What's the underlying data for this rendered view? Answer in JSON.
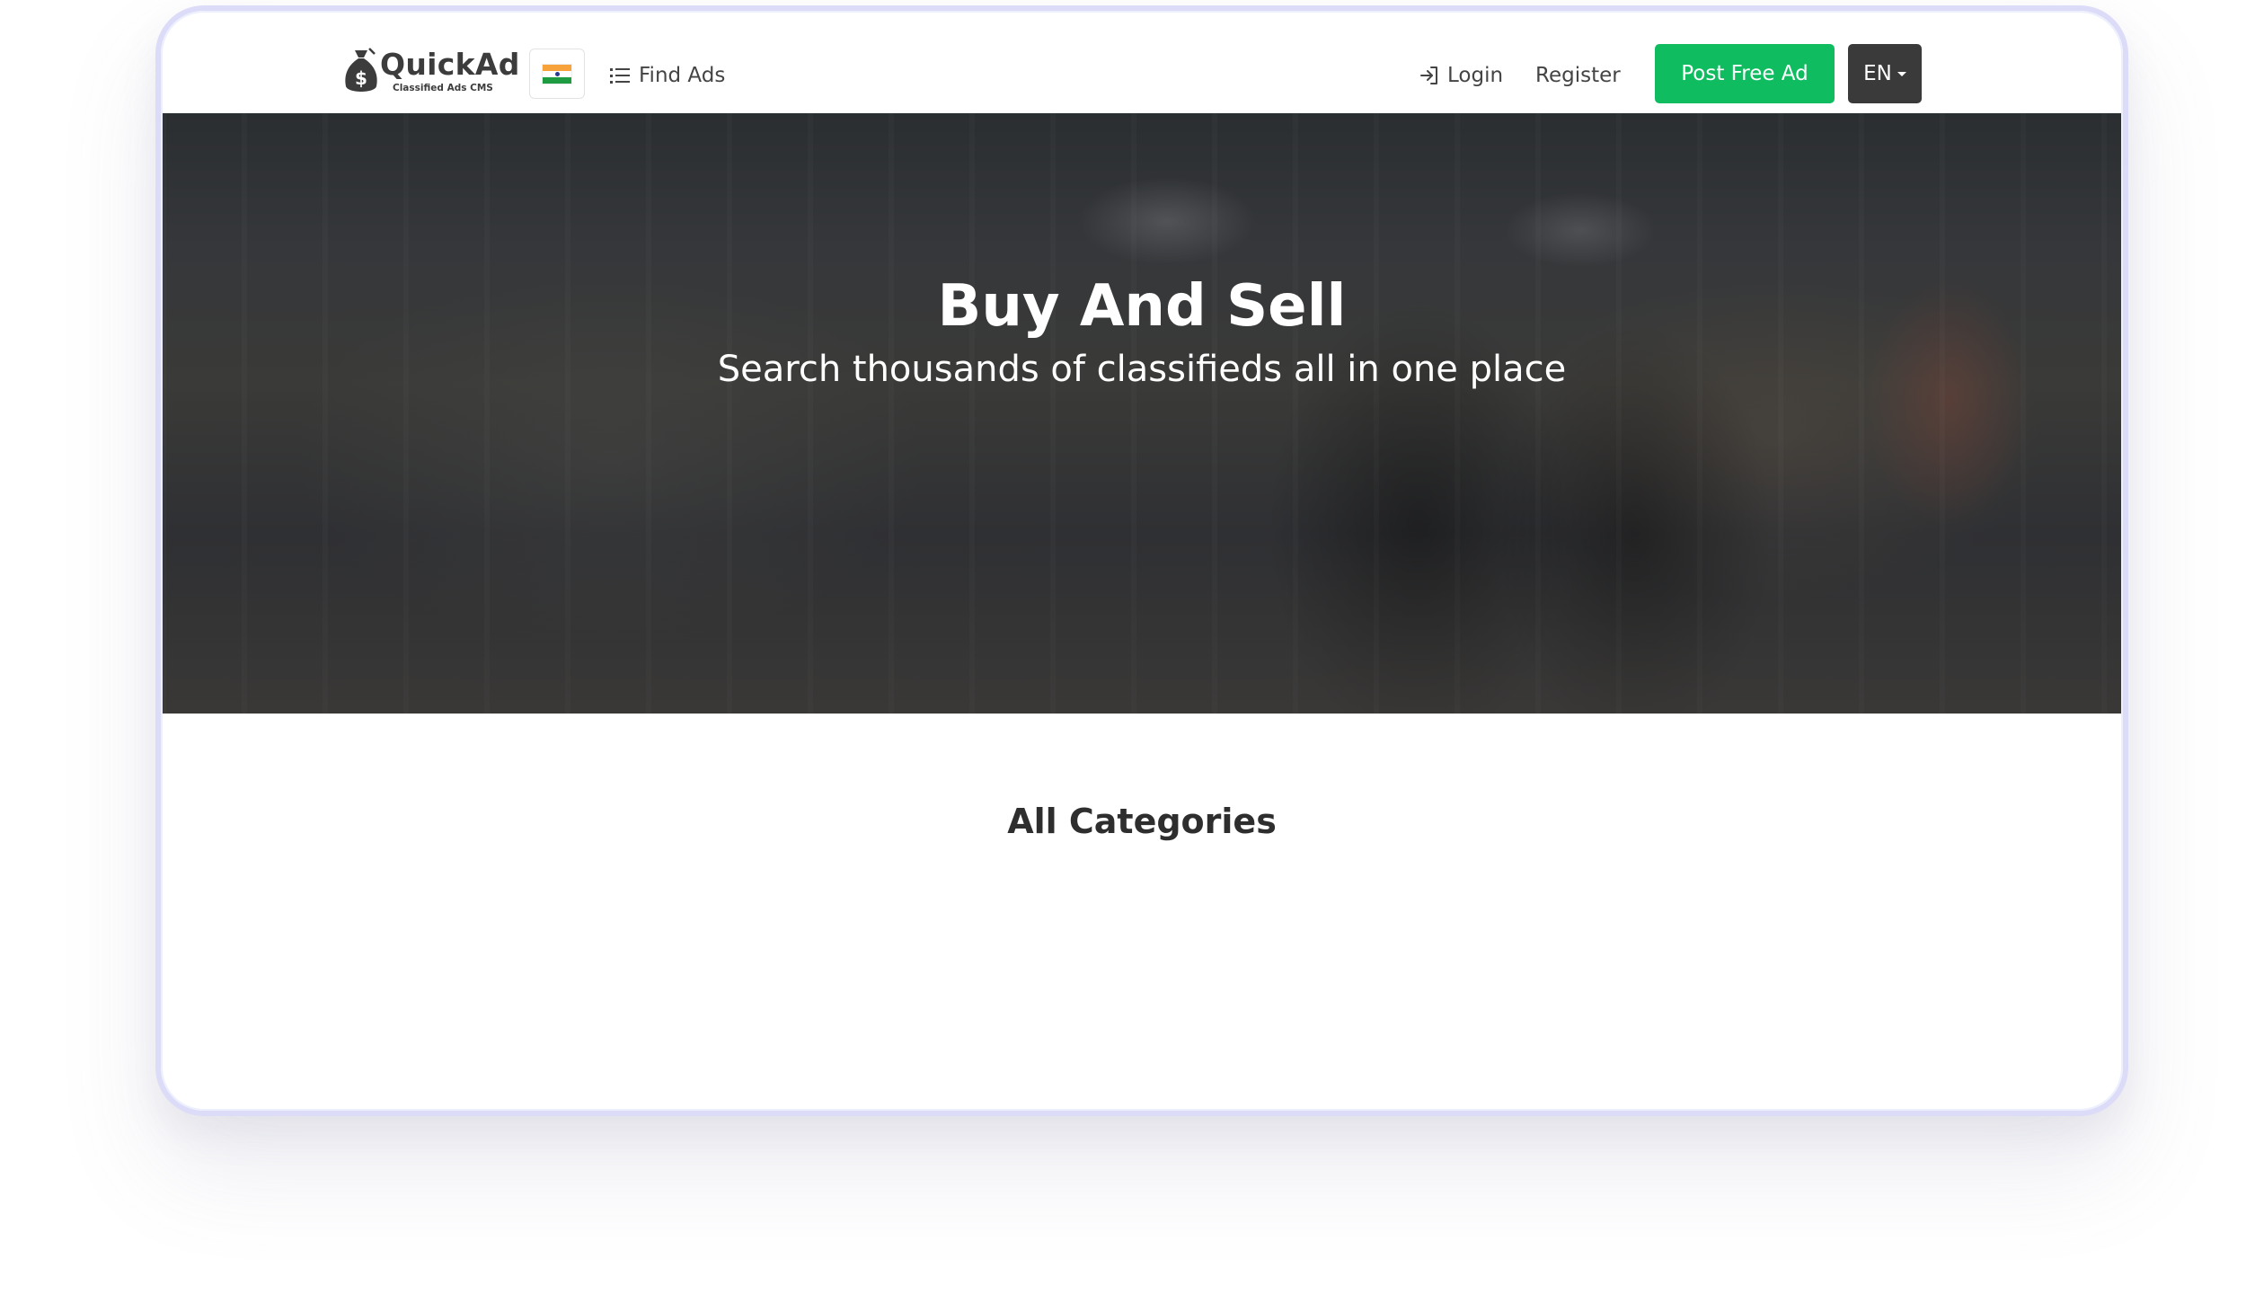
{
  "brand": {
    "name": "QuickAd",
    "tagline": "Classified Ads CMS",
    "icon": "money-bag-icon"
  },
  "nav": {
    "country_flag": "india-flag-icon",
    "find_ads_label": "Find Ads",
    "find_ads_icon": "list-icon",
    "login_label": "Login",
    "login_icon": "login-arrow-icon",
    "register_label": "Register",
    "post_ad_label": "Post Free Ad",
    "language_label": "EN"
  },
  "hero": {
    "title": "Buy And Sell",
    "subtitle": "Search thousands of classifieds all in one place"
  },
  "categories": {
    "title": "All Categories"
  },
  "colors": {
    "accent_green": "#0fbc60",
    "lang_bg": "#3a3a3a",
    "device_border": "#dcdcf8",
    "text_dark": "#444444"
  }
}
